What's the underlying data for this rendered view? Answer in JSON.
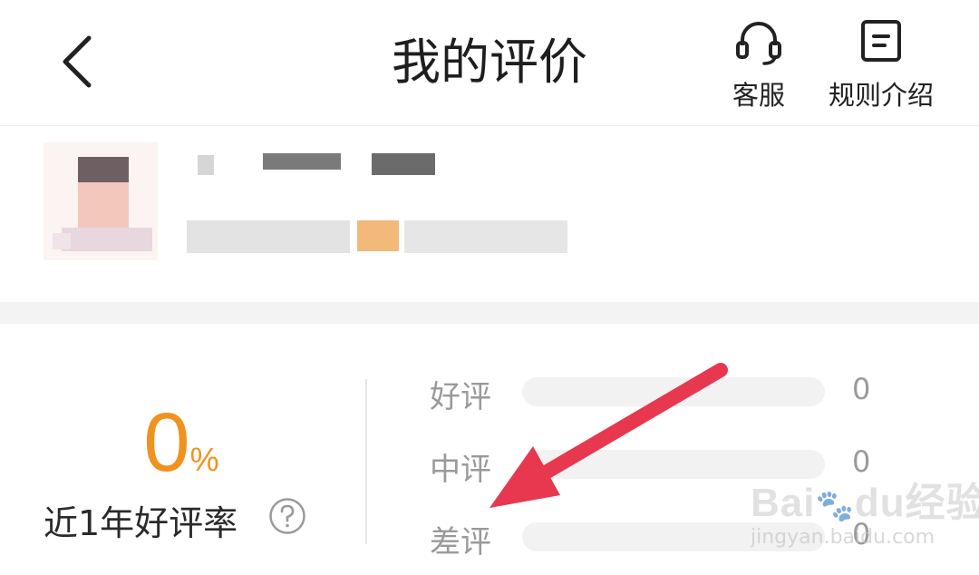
{
  "header": {
    "title": "我的评价",
    "back_icon": "chevron-left-icon",
    "actions": [
      {
        "label": "客服",
        "icon": "headset-icon"
      },
      {
        "label": "规则介绍",
        "icon": "document-icon"
      }
    ]
  },
  "profile": {
    "avatar_icon": "avatar",
    "name_redacted": true,
    "subtitle_redacted": true
  },
  "rating_summary": {
    "rate_value": "0",
    "rate_unit": "%",
    "rate_label": "近1年好评率",
    "help_icon": "question-circle-icon",
    "accent_color": "#f0921e",
    "rows": [
      {
        "label": "好评",
        "count": "0",
        "fraction": 0
      },
      {
        "label": "中评",
        "count": "0",
        "fraction": 0
      },
      {
        "label": "差评",
        "count": "0",
        "fraction": 0
      }
    ]
  },
  "annotation": {
    "arrow_color": "#e8384f",
    "arrow_target": "差评"
  },
  "watermark": {
    "brand": "Bai",
    "brand_suffix": "du",
    "brand_cn": "经验",
    "url": "jingyan.baidu.com"
  }
}
